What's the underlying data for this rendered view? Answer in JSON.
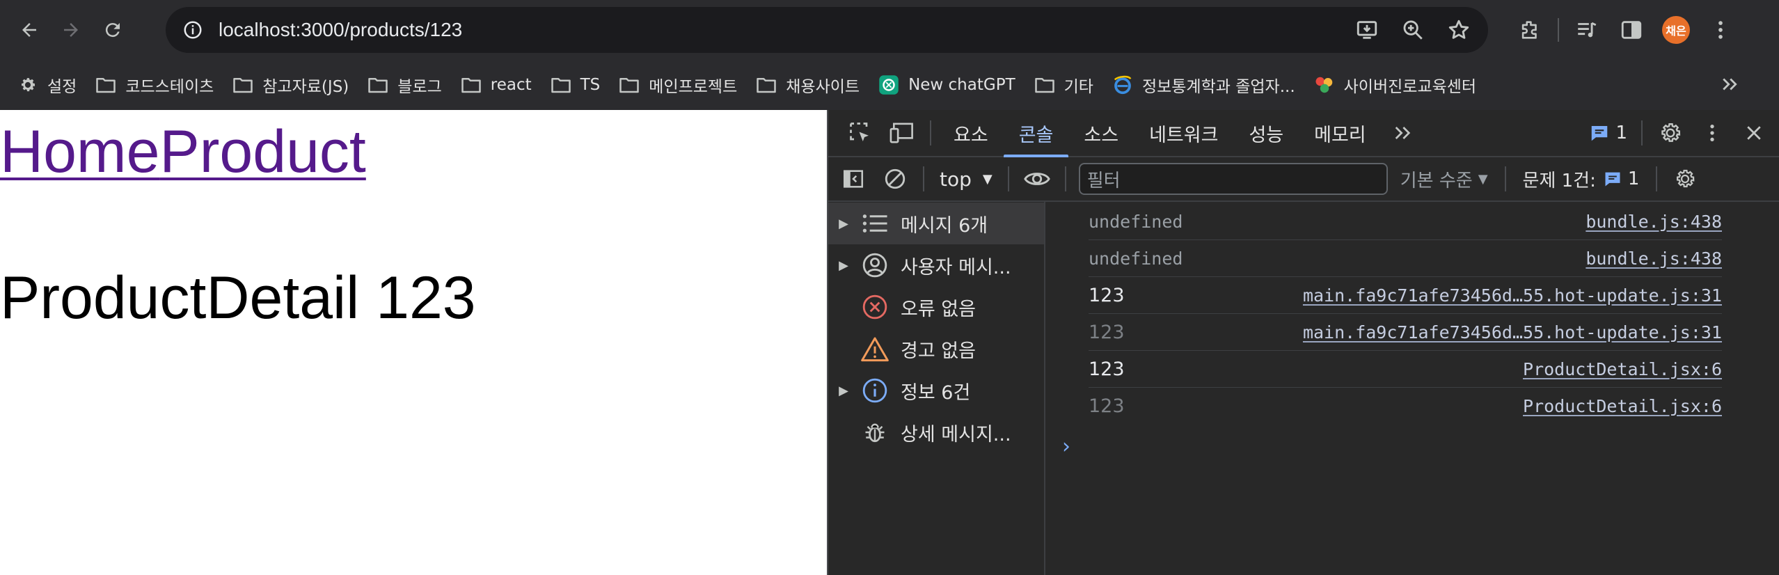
{
  "browser": {
    "url": "localhost:3000/products/123",
    "avatar_text": "채은"
  },
  "bookmarks": [
    {
      "label": "설정",
      "icon": "gear-icon"
    },
    {
      "label": "코드스테이츠",
      "icon": "folder-icon"
    },
    {
      "label": "참고자료(JS)",
      "icon": "folder-icon"
    },
    {
      "label": "블로그",
      "icon": "folder-icon"
    },
    {
      "label": "react",
      "icon": "folder-icon"
    },
    {
      "label": "TS",
      "icon": "folder-icon"
    },
    {
      "label": "메인프로젝트",
      "icon": "folder-icon"
    },
    {
      "label": "채용사이트",
      "icon": "folder-icon"
    },
    {
      "label": "New chatGPT",
      "icon": "chatgpt-icon"
    },
    {
      "label": "기타",
      "icon": "folder-icon"
    },
    {
      "label": "정보통계학과 졸업자...",
      "icon": "ie-icon"
    },
    {
      "label": "사이버진로교육센터",
      "icon": "site-icon"
    }
  ],
  "page": {
    "link_home": "Home",
    "link_product": "Product",
    "detail_text": "ProductDetail 123"
  },
  "devtools": {
    "tabs": [
      "요소",
      "콘솔",
      "소스",
      "네트워크",
      "성능",
      "메모리"
    ],
    "active_tab": "콘솔",
    "issues_badge": "1",
    "context": "top",
    "filter_placeholder": "필터",
    "levels_label": "기본 수준",
    "issues_label": "문제 1건:",
    "issues_count": "1",
    "sidebar": [
      {
        "label": "메시지 6개",
        "icon": "list-icon",
        "expandable": true
      },
      {
        "label": "사용자 메시...",
        "icon": "user-icon",
        "expandable": true
      },
      {
        "label": "오류 없음",
        "icon": "error-icon",
        "expandable": false
      },
      {
        "label": "경고 없음",
        "icon": "warning-icon",
        "expandable": false
      },
      {
        "label": "정보 6건",
        "icon": "info-icon",
        "expandable": true
      },
      {
        "label": "상세 메시지...",
        "icon": "bug-icon",
        "expandable": false
      }
    ],
    "logs": [
      {
        "message": "undefined",
        "source": "bundle.js:438",
        "style": "dim"
      },
      {
        "message": "undefined",
        "source": "bundle.js:438",
        "style": "dim"
      },
      {
        "message": "123",
        "source": "main.fa9c71afe73456d…55.hot-update.js:31",
        "style": "bright"
      },
      {
        "message": "123",
        "source": "main.fa9c71afe73456d…55.hot-update.js:31",
        "style": "faded"
      },
      {
        "message": "123",
        "source": "ProductDetail.jsx:6",
        "style": "bright"
      },
      {
        "message": "123",
        "source": "ProductDetail.jsx:6",
        "style": "faded"
      }
    ],
    "prompt_symbol": "›"
  }
}
